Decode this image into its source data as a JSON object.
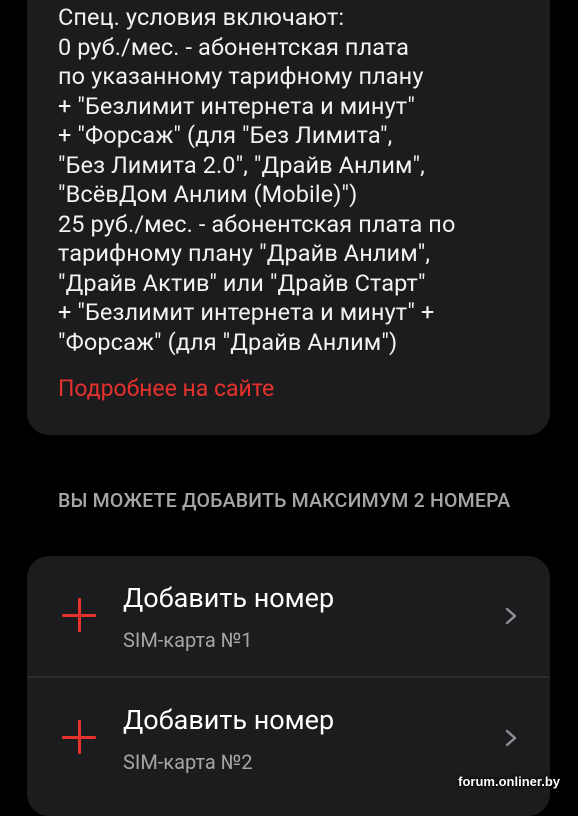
{
  "info_card": {
    "lines": [
      "Спец. условия включают:",
      "0 руб./мес. - абонентская плата",
      "по указанному тарифному плану",
      "+ \"Безлимит интернета и минут\"",
      "+ \"Форсаж\" (для \"Без Лимита\",",
      "\"Без Лимита 2.0\", \"Драйв Анлим\",",
      "\"ВсёвДом Анлим (Mobile)\")",
      "25 руб./мес. - абонентская плата по",
      "тарифному плану \"Драйв Анлим\",",
      "\"Драйв Актив\" или \"Драйв Старт\"",
      "+ \"Безлимит интернета и минут\" +",
      "\"Форсаж\" (для \"Драйв Анлим\")"
    ],
    "more_link": "Подробнее на сайте"
  },
  "add_numbers": {
    "header": "ВЫ МОЖЕТЕ ДОБАВИТЬ МАКСИМУМ 2 НОМЕРА",
    "rows": [
      {
        "title": "Добавить номер",
        "subtitle": "SIM-карта №1"
      },
      {
        "title": "Добавить номер",
        "subtitle": "SIM-карта №2"
      }
    ]
  },
  "watermark": "forum.onliner.by",
  "colors": {
    "accent": "#e5322d",
    "card_background": "#1c1c1e",
    "page_background": "#000000",
    "secondary_text": "#a6a6a6"
  },
  "icons": {
    "add": "plus-icon",
    "navigate": "chevron-right-icon"
  }
}
